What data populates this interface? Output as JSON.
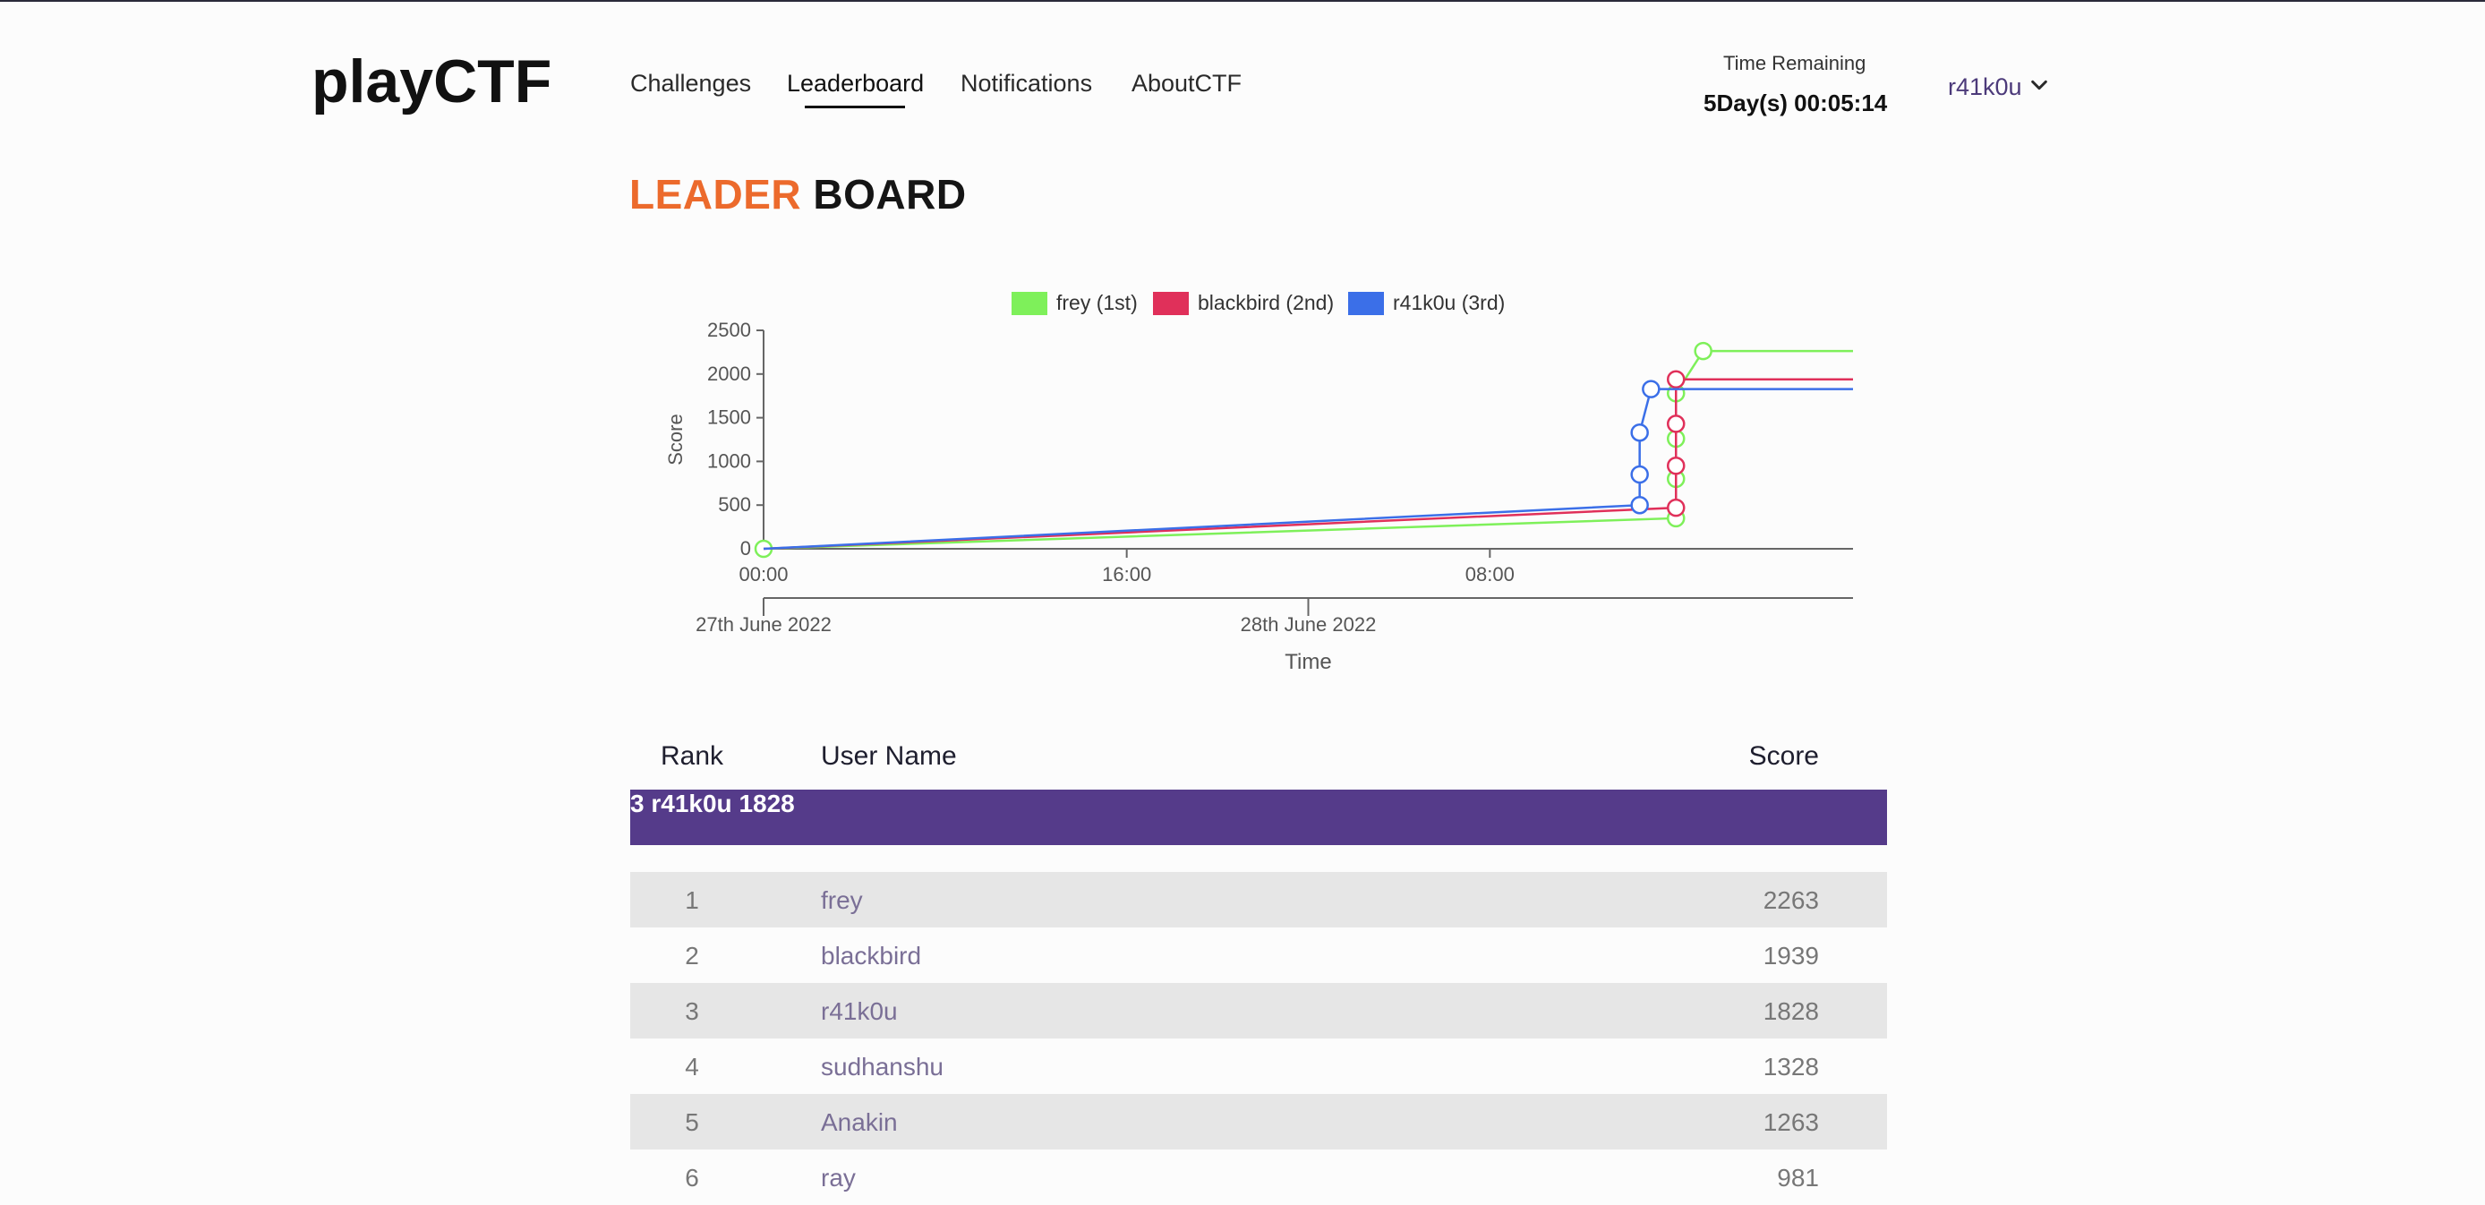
{
  "brand": {
    "logo": "playCTF"
  },
  "nav": {
    "items": [
      {
        "label": "Challenges"
      },
      {
        "label": "Leaderboard"
      },
      {
        "label": "Notifications"
      },
      {
        "label": "AboutCTF"
      }
    ],
    "active": "Leaderboard"
  },
  "timer": {
    "label": "Time Remaining",
    "value": "5Day(s) 00:05:14"
  },
  "user": {
    "name": "r41k0u",
    "icon": "chevron-down-icon"
  },
  "title": {
    "part1": "LEADER",
    "part2": "BOARD"
  },
  "colors": {
    "accent": "#ec6a2c",
    "highlight": "#553b8a"
  },
  "chart_data": {
    "type": "line",
    "ylabel": "Score",
    "xlabel": "Time",
    "ylim": [
      0,
      2500
    ],
    "yticks": [
      0,
      500,
      1000,
      1500,
      2000,
      2500
    ],
    "x_time_ticks": [
      "00:00",
      "16:00",
      "08:00"
    ],
    "x_date_ticks": [
      "27th June 2022",
      "28th June 2022"
    ],
    "legend_position": "top",
    "series": [
      {
        "name": "frey (1st)",
        "color": "#7ef05a",
        "points": [
          [
            0,
            0
          ],
          [
            40.2,
            350
          ],
          [
            40.2,
            800
          ],
          [
            40.2,
            1260
          ],
          [
            40.2,
            1780
          ],
          [
            41.4,
            2263
          ]
        ],
        "markers": [
          [
            0,
            0
          ],
          [
            40.2,
            350
          ],
          [
            40.2,
            800
          ],
          [
            40.2,
            1260
          ],
          [
            40.2,
            1780
          ],
          [
            41.4,
            2263
          ]
        ],
        "end_value": 2263
      },
      {
        "name": "blackbird (2nd)",
        "color": "#e0305a",
        "points": [
          [
            0,
            0
          ],
          [
            40.2,
            470
          ],
          [
            40.2,
            950
          ],
          [
            40.2,
            1430
          ],
          [
            40.2,
            1939
          ]
        ],
        "markers": [
          [
            40.2,
            470
          ],
          [
            40.2,
            950
          ],
          [
            40.2,
            1430
          ],
          [
            40.2,
            1939
          ]
        ],
        "end_value": 1939
      },
      {
        "name": "r41k0u (3rd)",
        "color": "#3b6fe8",
        "points": [
          [
            0,
            0
          ],
          [
            38.6,
            500
          ],
          [
            38.6,
            850
          ],
          [
            38.6,
            1330
          ],
          [
            39.1,
            1828
          ]
        ],
        "markers": [
          [
            38.6,
            500
          ],
          [
            38.6,
            850
          ],
          [
            38.6,
            1330
          ],
          [
            39.1,
            1828
          ]
        ],
        "end_value": 1828
      }
    ]
  },
  "leaderboard": {
    "headers": {
      "rank": "Rank",
      "name": "User Name",
      "score": "Score"
    },
    "me": {
      "rank": "3",
      "name": "r41k0u",
      "score": "1828"
    },
    "rows": [
      {
        "rank": "1",
        "name": "frey",
        "score": "2263"
      },
      {
        "rank": "2",
        "name": "blackbird",
        "score": "1939"
      },
      {
        "rank": "3",
        "name": "r41k0u",
        "score": "1828"
      },
      {
        "rank": "4",
        "name": "sudhanshu",
        "score": "1328"
      },
      {
        "rank": "5",
        "name": "Anakin",
        "score": "1263"
      },
      {
        "rank": "6",
        "name": "ray",
        "score": "981"
      }
    ]
  }
}
